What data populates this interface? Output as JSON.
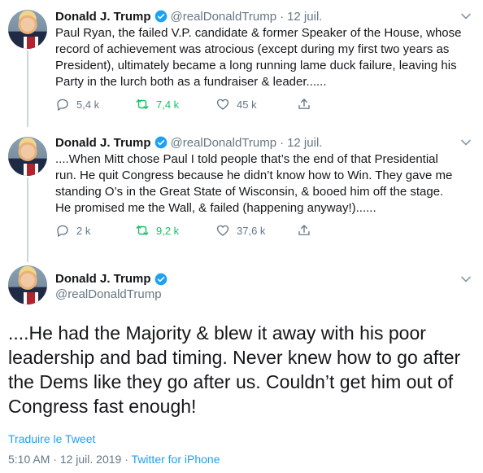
{
  "author": {
    "name": "Donald J. Trump",
    "handle": "@realDonaldTrump"
  },
  "colors": {
    "verified": "#1da1f2",
    "retweet": "#17bf63",
    "muted": "#657786",
    "link": "#1da1f2"
  },
  "tweets": [
    {
      "date": "12 juil.",
      "text": "Paul Ryan, the failed V.P. candidate & former Speaker of the House, whose record of achievement was atrocious (except during my first two years as President), ultimately became a long running lame duck failure, leaving his Party in the lurch both as a fundraiser & leader......",
      "replies": "5,4 k",
      "retweets": "7,4 k",
      "likes": "45 k"
    },
    {
      "date": "12 juil.",
      "text": "....When Mitt chose Paul I told people that’s the end of that Presidential run. He quit Congress because he didn’t know how to Win. They gave me standing O’s in the Great State of Wisconsin, & booed him off the stage. He promised me the Wall, & failed (happening anyway!)......",
      "replies": "2 k",
      "retweets": "9,2 k",
      "likes": "37,6 k"
    }
  ],
  "main_tweet": {
    "text": "....He had the Majority & blew it away with his poor leadership and bad timing. Never knew how to go after the Dems like they go after us. Couldn’t get him out of Congress fast enough!",
    "translate_label": "Traduire le Tweet",
    "time": "5:10 AM",
    "date": "12 juil. 2019",
    "separator": "·",
    "source": "Twitter for iPhone"
  },
  "icons": {
    "verified": "verified-badge-icon",
    "caret": "chevron-down-icon",
    "reply": "reply-icon",
    "retweet": "retweet-icon",
    "like": "heart-icon",
    "share": "share-icon"
  }
}
